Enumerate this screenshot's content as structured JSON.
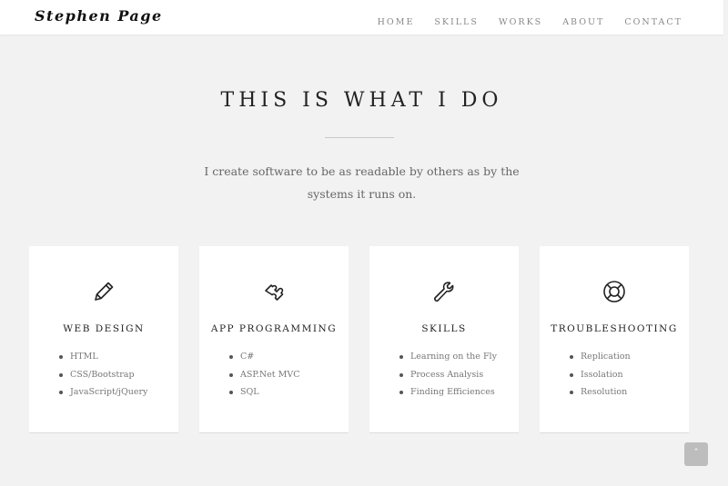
{
  "navbar": {
    "brand": "Stephen Page",
    "items": [
      {
        "label": "HOME"
      },
      {
        "label": "SKILLS"
      },
      {
        "label": "WORKS"
      },
      {
        "label": "ABOUT"
      },
      {
        "label": "CONTACT"
      }
    ]
  },
  "hero": {
    "title": "THIS IS WHAT I DO",
    "text": "I create software to be as readable by others as by the systems it runs on."
  },
  "cards": [
    {
      "icon": "pencil-icon",
      "title": "WEB DESIGN",
      "items": [
        "HTML",
        "CSS/Bootstrap",
        "JavaScript/jQuery"
      ]
    },
    {
      "icon": "puzzle-icon",
      "title": "APP PROGRAMMING",
      "items": [
        "C#",
        "ASP.Net MVC",
        "SQL"
      ]
    },
    {
      "icon": "wrench-icon",
      "title": "SKILLS",
      "items": [
        "Learning on the Fly",
        "Process Analysis",
        "Finding Efficiences"
      ]
    },
    {
      "icon": "life-ring-icon",
      "title": "TROUBLESHOOTING",
      "items": [
        "Replication",
        "Issolation",
        "Resolution"
      ]
    }
  ],
  "back_to_top": {
    "icon": "chevron-up-icon"
  },
  "colors": {
    "background": "#f2f2f2",
    "card": "#ffffff",
    "button": "#bdbdbd"
  }
}
